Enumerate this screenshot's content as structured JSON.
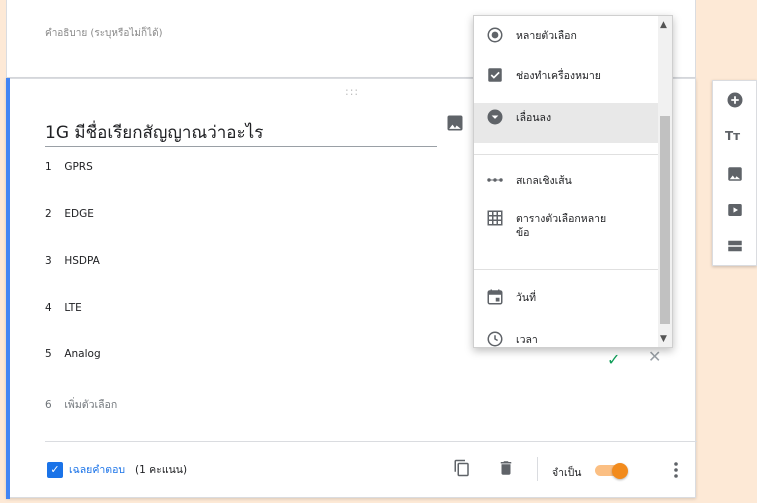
{
  "form": {
    "description_placeholder": "คำอธิบาย (ระบุหรือไม่ก็ได้)"
  },
  "question": {
    "title": "1G มีชื่อเรียกสัญญาณว่าอะไร",
    "drag_handle": ":::",
    "options": [
      {
        "num": "1",
        "label": "GPRS"
      },
      {
        "num": "2",
        "label": "EDGE"
      },
      {
        "num": "3",
        "label": "HSDPA"
      },
      {
        "num": "4",
        "label": "LTE"
      },
      {
        "num": "5",
        "label": "Analog"
      }
    ],
    "add_option": {
      "num": "6",
      "label": "เพิ่มตัวเลือก"
    },
    "check_glyph": "✓",
    "remove_glyph": "✕"
  },
  "footer": {
    "answer_key_label": "เฉลยคำตอบ",
    "points": "(1 คะแนน)",
    "required_label": "จำเป็น",
    "required_on": true
  },
  "type_menu": {
    "items": [
      {
        "label": "หลายตัวเลือก",
        "icon": "radio-icon"
      },
      {
        "label": "ช่องทำเครื่องหมาย",
        "icon": "checkbox-icon"
      },
      {
        "label": "เลื่อนลง",
        "icon": "dropdown-icon",
        "selected": true
      },
      {
        "label": "สเกลเชิงเส้น",
        "icon": "linear-scale-icon"
      },
      {
        "label": "ตารางตัวเลือกหลาย\nข้อ",
        "icon": "grid-icon"
      },
      {
        "label": "วันที่",
        "icon": "calendar-icon"
      },
      {
        "label": "เวลา",
        "icon": "clock-icon"
      }
    ]
  },
  "side_toolbar": {
    "title_text_glyph": "Tт"
  },
  "colors": {
    "accent": "#4285f4",
    "answer_key_blue": "#1a73e8",
    "toggle_orange": "#f28b1d",
    "background": "#fde9d6",
    "check_green": "#0f9d58"
  }
}
